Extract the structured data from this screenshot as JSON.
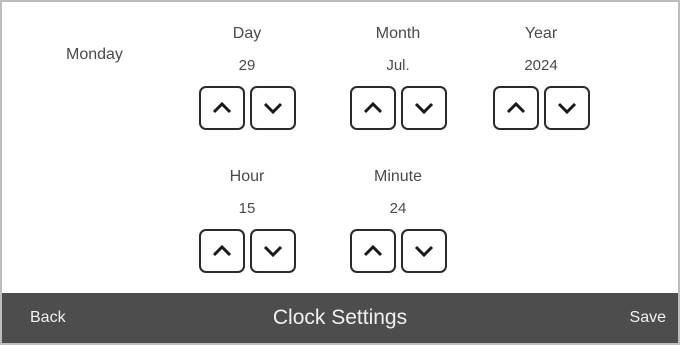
{
  "weekday": "Monday",
  "date": {
    "day": {
      "label": "Day",
      "value": "29"
    },
    "month": {
      "label": "Month",
      "value": "Jul."
    },
    "year": {
      "label": "Year",
      "value": "2024"
    }
  },
  "time": {
    "hour": {
      "label": "Hour",
      "value": "15"
    },
    "minute": {
      "label": "Minute",
      "value": "24"
    }
  },
  "bottom_bar": {
    "back_label": "Back",
    "title": "Clock Settings",
    "save_label": "Save"
  },
  "icons": {
    "increment": "chevron-up-icon",
    "decrement": "chevron-down-icon"
  },
  "colors": {
    "bar_background": "#4d4d4d",
    "bar_text": "#f0f0f0",
    "button_border": "#2a2a2a",
    "text": "#4a4a4a"
  }
}
